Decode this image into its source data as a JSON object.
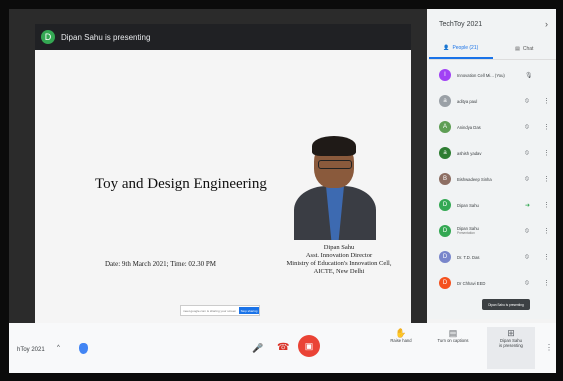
{
  "presenting_bar": {
    "avatar_letter": "D",
    "text": "Dipan Sahu is presenting"
  },
  "slide": {
    "title": "Toy and Design Engineering",
    "date_line": "Date: 9th March 2021; Time: 02.30 PM",
    "presenter_name": "Dipan Sahu",
    "presenter_role": "Asst. Innovation Director",
    "presenter_org": "Ministry of Education's Innovation Cell,",
    "presenter_org2": "AICTE, New Delhi",
    "mini_toolbar_text": "meet.google.com is sharing your screen",
    "mini_toolbar_button": "Stop sharing"
  },
  "panel": {
    "title": "TechToy 2021",
    "close_icon": "close-icon",
    "tabs": {
      "people": "People (21)",
      "chat": "Chat"
    },
    "people": [
      {
        "letter": "I",
        "name": "Innovation Cell Mi... (You)",
        "sub": "",
        "color": "#a142f4"
      },
      {
        "letter": "a",
        "name": "aditya paul",
        "sub": "",
        "color": "#9aa0a6"
      },
      {
        "letter": "A",
        "name": "Anindya Das",
        "sub": "",
        "color": "#5f9e55"
      },
      {
        "letter": "a",
        "name": "ashish yadav",
        "sub": "",
        "color": "#2e7d32"
      },
      {
        "letter": "B",
        "name": "Bishwadeep Sinha",
        "sub": "",
        "color": "#8d6e63"
      },
      {
        "letter": "D",
        "name": "Dipan Sahu",
        "sub": "",
        "color": "#34a853"
      },
      {
        "letter": "D",
        "name": "Dipan Sahu",
        "sub": "Presentation",
        "color": "#34a853"
      },
      {
        "letter": "D",
        "name": "Dr. T.D. Das",
        "sub": "",
        "color": "#7986cb"
      },
      {
        "letter": "D",
        "name": "Dr Chhavi EED",
        "sub": "",
        "color": "#f4511e"
      }
    ]
  },
  "tooltip": "Dipan Sahu is presenting",
  "bottombar": {
    "meeting_name": "hToy 2021",
    "raise_hand": "Raise hand",
    "captions": "Turn on captions",
    "present_line1": "Dipan Sahu",
    "present_line2": "is presenting"
  },
  "colors": {
    "accent": "#1a73e8",
    "danger": "#ea4335"
  }
}
